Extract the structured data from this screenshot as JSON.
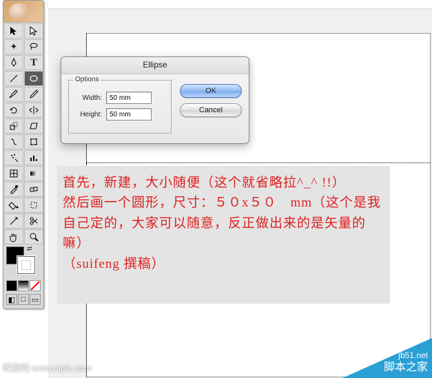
{
  "dialog": {
    "title": "Ellipse",
    "options_legend": "Options",
    "width_label": "Width:",
    "height_label": "Height:",
    "width_value": "50 mm",
    "height_value": "50 mm",
    "ok": "OK",
    "cancel": "Cancel"
  },
  "instructions": {
    "line1": "首先，新建，大小随便（这个就省略拉^_^ !!）",
    "line2": "然后画一个圆形，尺寸：５０x５０　mm（这个是我自己定的，大家可以随意，反正做出来的是矢量的嘛）",
    "line3": "（suifeng 撰稿）"
  },
  "watermarks": {
    "bottom_left": "昵图网 www.nipic.com",
    "bottom_right_site": "jb51.net",
    "bottom_right_cn": "脚本之家"
  },
  "tools": {
    "row1": [
      "selection",
      "direct-selection"
    ],
    "row2": [
      "magic-wand",
      "lasso"
    ],
    "row3": [
      "pen",
      "type"
    ],
    "row4": [
      "line-segment",
      "ellipse"
    ],
    "row5": [
      "paintbrush",
      "pencil"
    ],
    "row6": [
      "rotate",
      "reflect"
    ],
    "row7": [
      "scale",
      "shear"
    ],
    "row8": [
      "warp",
      "free-transform"
    ],
    "row9": [
      "symbol-sprayer",
      "column-graph"
    ],
    "row10": [
      "mesh",
      "gradient"
    ],
    "row11": [
      "eyedropper",
      "blend"
    ],
    "row12": [
      "live-paint",
      "live-paint-select"
    ],
    "row13": [
      "slice",
      "scissors"
    ],
    "row14": [
      "hand",
      "zoom"
    ]
  }
}
